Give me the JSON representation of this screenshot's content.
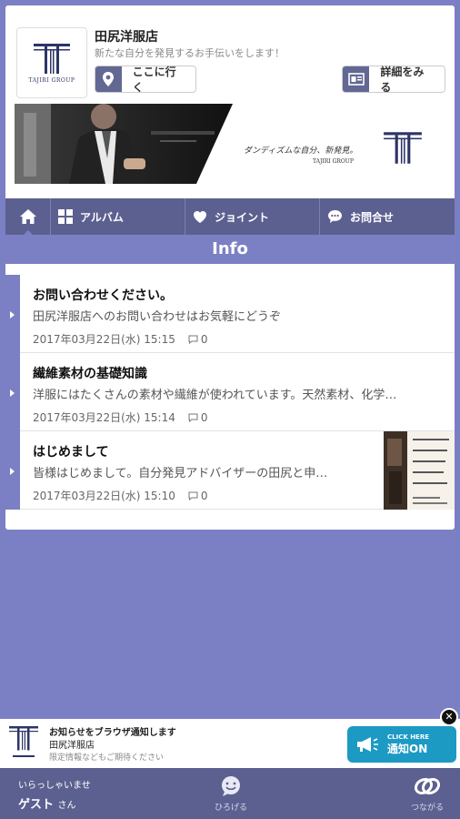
{
  "shop": {
    "name": "田尻洋服店",
    "tagline": "新たな自分を発見するお手伝いをします！",
    "logo_text": "TAJIRI GROUP",
    "go_button": "ここに行く",
    "detail_button": "詳細をみる"
  },
  "banner": {
    "slogan": "ダンディズムな自分、新発見。",
    "group": "TAJIRI GROUP"
  },
  "nav": {
    "album": "アルバム",
    "joint": "ジョイント",
    "contact": "お問合せ"
  },
  "section_title": "Info",
  "posts": [
    {
      "title": "お問い合わせください。",
      "summary": "田尻洋服店へのお問い合わせはお気軽にどうぞ",
      "date": "2017年03月22日(水) 15:15",
      "comments": "0"
    },
    {
      "title": "繊維素材の基礎知識",
      "summary": "洋服にはたくさんの素材や繊維が使われています。天然素材、化学…",
      "date": "2017年03月22日(水) 15:14",
      "comments": "0"
    },
    {
      "title": "はじめまして",
      "summary": "皆様はじめまして。自分発見アドバイザーの田尻と申…",
      "date": "2017年03月22日(水) 15:10",
      "comments": "0"
    }
  ],
  "promo": {
    "title": "お知らせをブラウザ通知します",
    "shop_name": "田尻洋服店",
    "subtitle": "限定情報などもご期待ください",
    "button_small": "CLICK HERE",
    "button_big": "通知ON",
    "close": "✕"
  },
  "footer": {
    "greeting": "いらっしゃいませ",
    "user": "ゲスト",
    "user_suffix": "さん",
    "spread_label": "ひろげる",
    "connect_label": "つながる"
  },
  "colors": {
    "background": "#7b80c4",
    "nav": "#5c6090",
    "promo_button": "#1c9ac4"
  }
}
